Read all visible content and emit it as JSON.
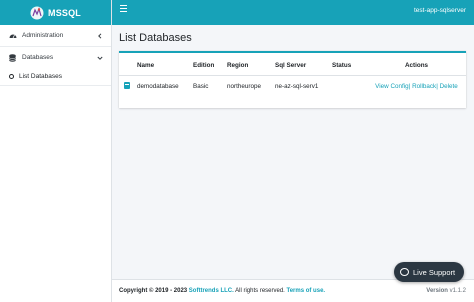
{
  "brand": {
    "name": "MSSQL"
  },
  "topbar": {
    "server_name": "test-app-sqlserver"
  },
  "sidebar": {
    "items": [
      {
        "label": "Administration",
        "icon": "dashboard-icon",
        "chevron": "chevron-left-icon"
      },
      {
        "label": "Databases",
        "icon": "database-icon",
        "chevron": "chevron-down-icon"
      }
    ],
    "sub_items": [
      {
        "label": "List Databases",
        "icon": "circle-icon"
      }
    ]
  },
  "main": {
    "title": "List Databases",
    "table": {
      "headers": [
        "Name",
        "Edition",
        "Region",
        "Sql Server",
        "Status",
        "Actions"
      ],
      "rows": [
        {
          "name": "demodatabase",
          "edition": "Basic",
          "region": "northeurope",
          "sql_server": "ne-az-sql-serv1",
          "status": "",
          "actions": {
            "view": "View Config",
            "rollback": "Rollback",
            "delete": "Delete",
            "sep": "|"
          }
        }
      ]
    }
  },
  "footer": {
    "copyright_prefix": "Copyright © 2019 - 2023",
    "company": "Softtrends LLC.",
    "rights": "All rights reserved.",
    "terms": "Terms of use.",
    "version_label": "Version",
    "version": "v1.1.2"
  },
  "live_support": {
    "label": "Live Support"
  },
  "colors": {
    "accent": "#17a2b8",
    "dark": "#2b3742"
  }
}
